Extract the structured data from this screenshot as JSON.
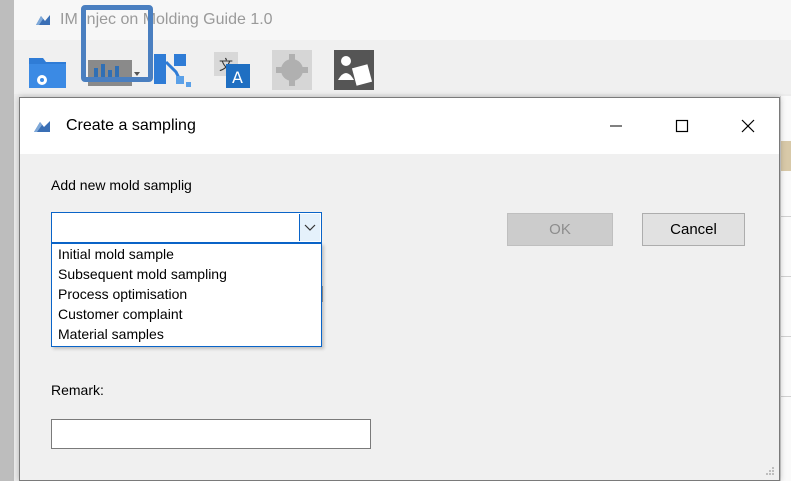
{
  "main_window": {
    "title": "IMG - Injection Molding Guide 1.0",
    "title_visible": "IM     Injec    on Molding Guide 1.0"
  },
  "toolbar": {
    "buttons": [
      {
        "name": "settings-folder-icon",
        "color": "#2f7cd6"
      },
      {
        "name": "chart-dropdown-icon",
        "color": "#2f6fb5"
      },
      {
        "name": "network-diagram-icon",
        "color": "#2f7cd6"
      },
      {
        "name": "translate-icon",
        "color": "#1f6fc2"
      },
      {
        "name": "gear-icon",
        "color": "#b0b0b0"
      },
      {
        "name": "reader-icon",
        "color": "#555555"
      }
    ],
    "highlight_color": "#4a7fc0"
  },
  "dialog": {
    "title": "Create a sampling",
    "minimize_glyph": "—",
    "maximize_glyph": "☐",
    "close_glyph": "✕",
    "add_label": "Add new mold samplig",
    "combo_value": "",
    "dropdown_arrow": "⌄",
    "options": [
      "Initial mold sample",
      "Subsequent mold sampling",
      "Process optimisation",
      "Customer complaint",
      "Material samples"
    ],
    "ok_label": "OK",
    "cancel_label": "Cancel",
    "remark_label": "Remark:",
    "remark_value": ""
  }
}
